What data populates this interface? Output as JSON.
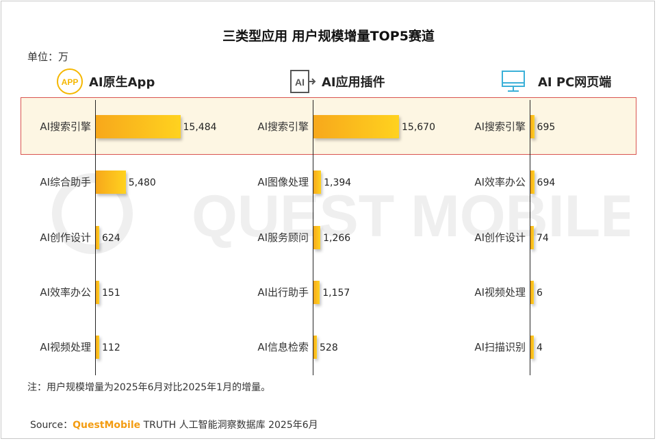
{
  "title": "三类型应用 用户规模增量TOP5赛道",
  "unit": "单位：万",
  "note": "注：用户规模增量为2025年6月对比2025年1月的增量。",
  "source": {
    "prefix": "Source：",
    "brand": "QuestMobile",
    "rest": " TRUTH 人工智能洞察数据库 2025年6月"
  },
  "watermark_text": "QUEST MOBILE",
  "icons": {
    "app_badge": "APP",
    "plugin_glyph": "AI"
  },
  "colors": {
    "bar_start": "#f7a81b",
    "bar_end": "#ffd21f",
    "highlight_border": "#d9534f",
    "highlight_fill": "#fdf6e3",
    "brand": "#f39c12"
  },
  "chart_data": [
    {
      "type": "bar",
      "title": "AI原生App",
      "icon": "app-icon",
      "categories": [
        "AI搜索引擎",
        "AI综合助手",
        "AI创作设计",
        "AI效率办公",
        "AI视频处理"
      ],
      "values": [
        15484,
        5480,
        624,
        151,
        112
      ],
      "labels": [
        "15,484",
        "5,480",
        "624",
        "151",
        "112"
      ]
    },
    {
      "type": "bar",
      "title": "AI应用插件",
      "icon": "plugin-icon",
      "categories": [
        "AI搜索引擎",
        "AI图像处理",
        "AI服务顾问",
        "AI出行助手",
        "AI信息检索"
      ],
      "values": [
        15670,
        1394,
        1266,
        1157,
        528
      ],
      "labels": [
        "15,670",
        "1,394",
        "1,266",
        "1,157",
        "528"
      ]
    },
    {
      "type": "bar",
      "title": "AI PC网页端",
      "icon": "monitor-icon",
      "categories": [
        "AI搜索引擎",
        "AI效率办公",
        "AI创作设计",
        "AI视频处理",
        "AI扫描识别"
      ],
      "values": [
        695,
        694,
        74,
        6,
        4
      ],
      "labels": [
        "695",
        "694",
        "74",
        "6",
        "4"
      ]
    }
  ]
}
